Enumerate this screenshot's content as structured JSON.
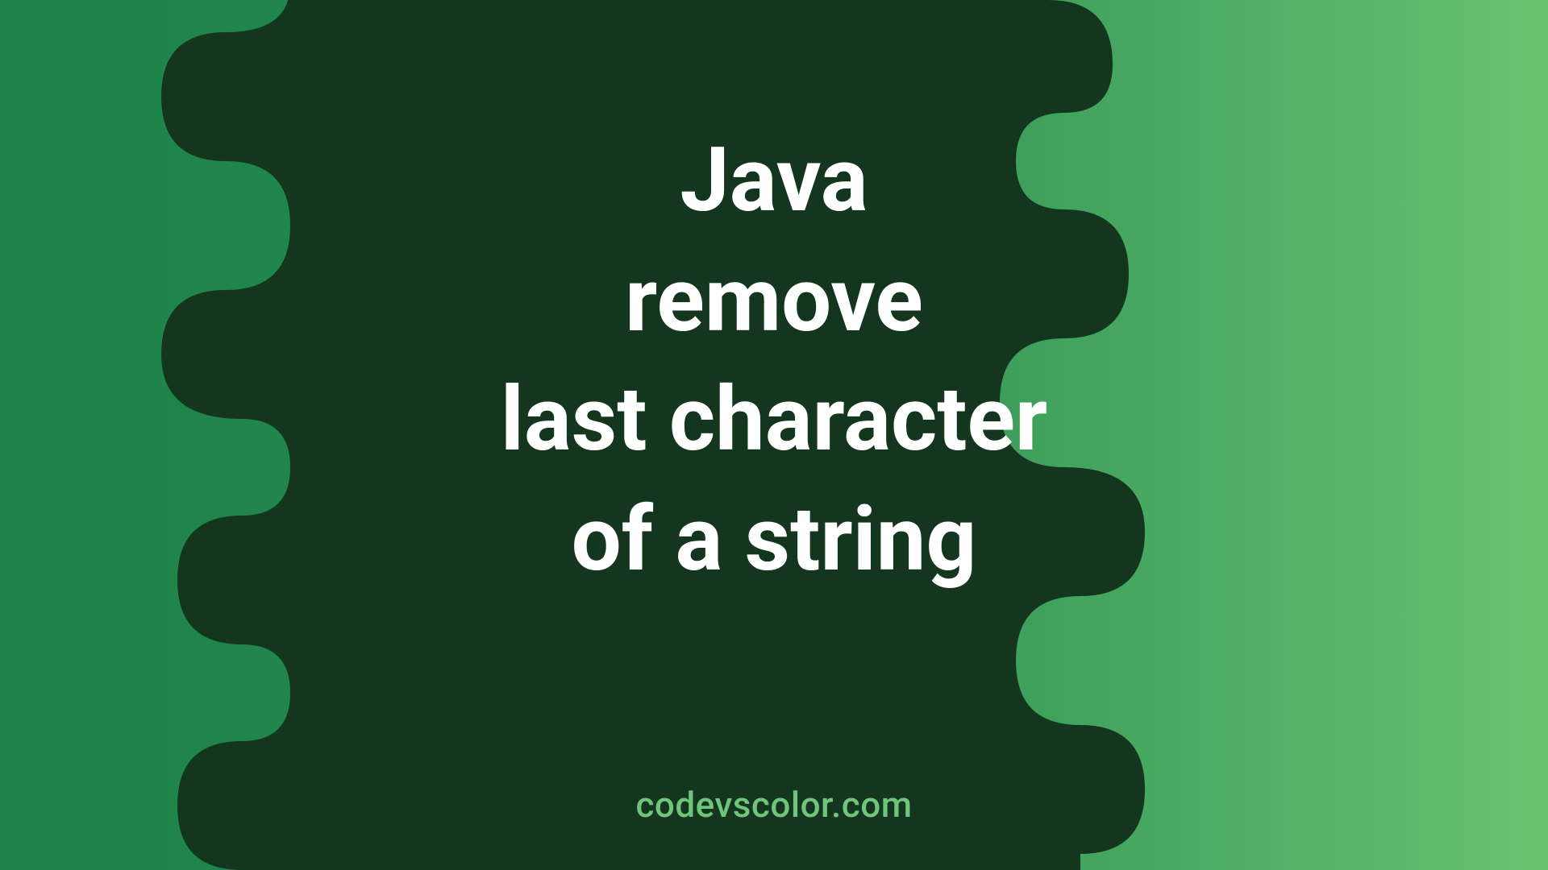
{
  "title": {
    "line1": "Java",
    "line2": "remove",
    "line3": "last character",
    "line4": "of a string"
  },
  "watermark": "codevscolor.com",
  "colors": {
    "bg_gradient_start": "#1e8349",
    "bg_gradient_end": "#68c371",
    "blob_dark": "#14361f",
    "text": "#ffffff",
    "watermark": "#6fc67a"
  }
}
